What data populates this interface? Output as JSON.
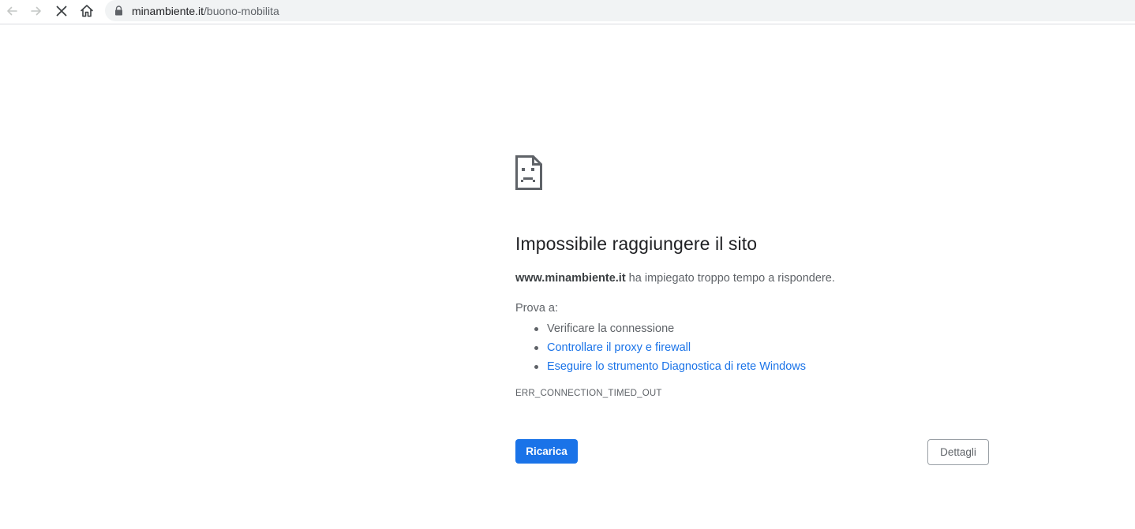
{
  "toolbar": {
    "back_icon": "arrow-left-icon",
    "forward_icon": "arrow-right-icon",
    "stop_icon": "close-icon",
    "home_icon": "home-icon",
    "lock_icon": "lock-icon",
    "url_host": "minambiente.it",
    "url_path": "/buono-mobilita"
  },
  "error": {
    "icon": "sad-page-icon",
    "title": "Impossibile raggiungere il sito",
    "site": "www.minambiente.it",
    "message": " ha impiegato troppo tempo a rispondere.",
    "try_label": "Prova a:",
    "suggestions": [
      {
        "text": "Verificare la connessione",
        "link": false
      },
      {
        "text": "Controllare il proxy e firewall",
        "link": true
      },
      {
        "text": "Eseguire lo strumento Diagnostica di rete Windows",
        "link": true
      }
    ],
    "code": "ERR_CONNECTION_TIMED_OUT"
  },
  "buttons": {
    "reload": "Ricarica",
    "details": "Dettagli"
  },
  "colors": {
    "accent": "#1a73e8",
    "text_secondary": "#5f6368",
    "omnibox_bg": "#f1f3f4"
  }
}
